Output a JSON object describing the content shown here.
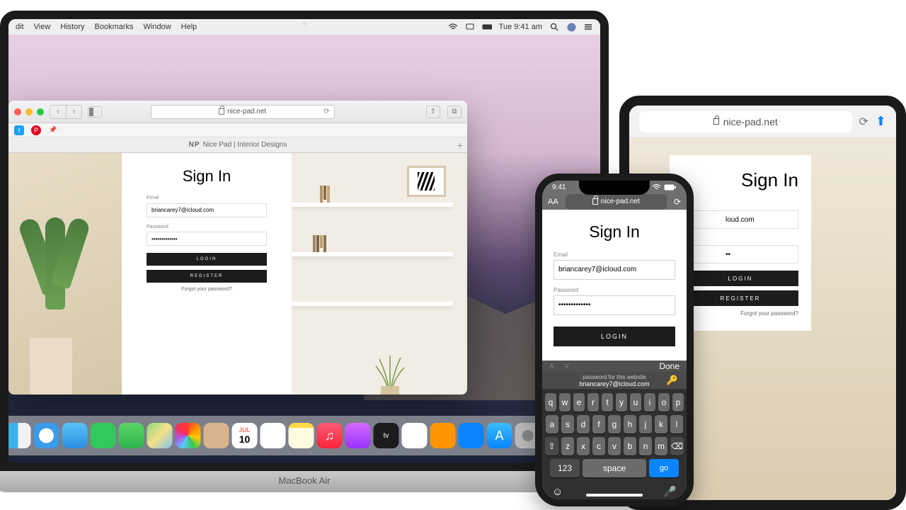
{
  "mac": {
    "menubar": {
      "items": [
        "dit",
        "View",
        "History",
        "Bookmarks",
        "Window",
        "Help"
      ],
      "clock": "Tue 9:41 am"
    },
    "safari": {
      "url": "nice-pad.net",
      "tab_prefix": "NP",
      "tab_title": "Nice Pad | Interior Designs"
    },
    "device_label": "MacBook Air"
  },
  "ipad": {
    "url": "nice-pad.net"
  },
  "iphone": {
    "time": "9:41",
    "url": "nice-pad.net",
    "aa": "AA",
    "kb": {
      "done": "Done",
      "autofill_label": "password for this website",
      "autofill_value": "briancarey7@icloud.com",
      "row1": [
        "q",
        "w",
        "e",
        "r",
        "t",
        "y",
        "u",
        "i",
        "o",
        "p"
      ],
      "row2": [
        "a",
        "s",
        "d",
        "f",
        "g",
        "h",
        "j",
        "k",
        "l"
      ],
      "row3": [
        "z",
        "x",
        "c",
        "v",
        "b",
        "n",
        "m"
      ],
      "num": "123",
      "space": "space",
      "go": "go"
    }
  },
  "signin": {
    "title": "Sign In",
    "email_label": "Email",
    "email_value": "briancarey7@icloud.com",
    "password_label": "Password",
    "password_value": "•••••••••••••",
    "login": "LOGIN",
    "register": "REGISTER",
    "forgot": "Forgot your password?"
  },
  "ipad_signin": {
    "email_value": "loud.com",
    "password_value": "••"
  },
  "dock": {
    "icons": [
      "finder",
      "safari",
      "mail",
      "messages",
      "maps",
      "photos",
      "contacts",
      "calendar",
      "reminders",
      "notes",
      "music",
      "podcasts",
      "tv",
      "numbers",
      "pages",
      "keynote",
      "appstore",
      "settings"
    ]
  }
}
